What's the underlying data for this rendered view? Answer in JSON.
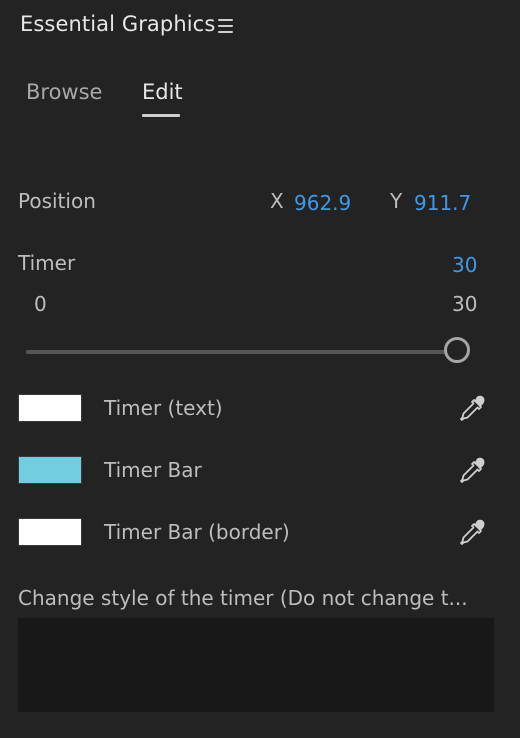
{
  "panel": {
    "title": "Essential Graphics"
  },
  "tabs": [
    {
      "label": "Browse",
      "active": false
    },
    {
      "label": "Edit",
      "active": true
    }
  ],
  "position": {
    "label": "Position",
    "x_label": "X",
    "x_value": "962.9",
    "y_label": "Y",
    "y_value": "911.7"
  },
  "timer": {
    "label": "Timer",
    "value": "30",
    "min_label": "0",
    "max_label": "30",
    "slider_level": 1.0
  },
  "colors": [
    {
      "label": "Timer (text)",
      "swatch": "#ffffff"
    },
    {
      "label": "Timer Bar",
      "swatch": "#72cde0"
    },
    {
      "label": "Timer Bar (border)",
      "swatch": "#ffffff"
    }
  ],
  "style_field": {
    "label": "Change style of the timer (Do not change t...",
    "value": ""
  },
  "theme": {
    "background": "#232323",
    "accent": "#3e9ae8",
    "field_background": "#181818"
  }
}
